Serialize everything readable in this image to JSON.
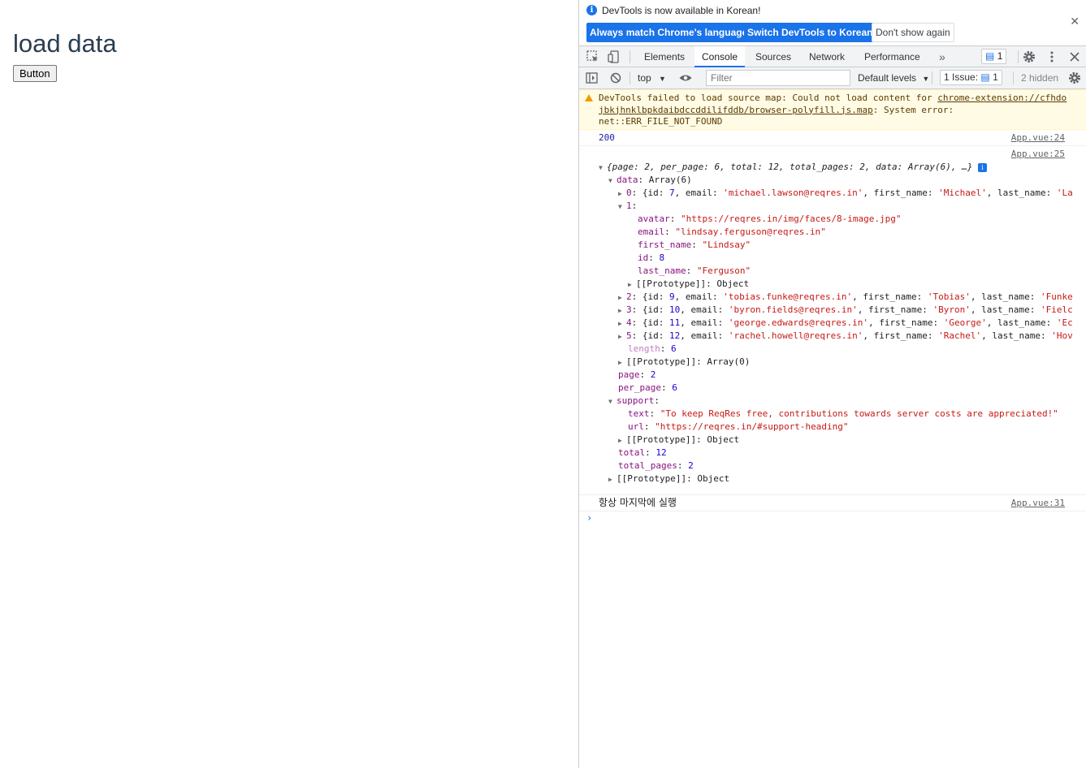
{
  "page": {
    "heading": "load data",
    "button_label": "Button"
  },
  "infobar": {
    "message": "DevTools is now available in Korean!",
    "btn_match": "Always match Chrome's language",
    "btn_switch": "Switch DevTools to Korean",
    "btn_dont_show": "Don't show again"
  },
  "tabs": [
    "Elements",
    "Console",
    "Sources",
    "Network",
    "Performance"
  ],
  "tabs_more": "»",
  "message_badge_count": "1",
  "toolbar": {
    "context": "top",
    "filter_placeholder": "Filter",
    "levels": "Default levels",
    "issue_label": "1 Issue:",
    "issue_count": "1",
    "hidden": "2 hidden"
  },
  "console": {
    "warning": {
      "prefix": "DevTools failed to load source map: Could not load content for ",
      "link1": "chrome-extension://cfhdo",
      "link2": "jbkjhnklbpkdaibdccddilifddb/browser-polyfill.js.map",
      "suffix": ": System error:",
      "line3": "net::ERR_FILE_NOT_FOUND"
    },
    "log200": {
      "value": "200",
      "source": "App.vue:24"
    },
    "object_source": "App.vue:25",
    "summary": "{page: 2, per_page: 6, total: 12, total_pages: 2, data: Array(6), …}",
    "data_label": "data",
    "data_type": "Array(6)",
    "rows": [
      {
        "index": "0",
        "id": "7",
        "email": "'michael.lawson@reqres.in'",
        "first_name": "'Michael'",
        "last_name_start": "'La"
      },
      {
        "index": "2",
        "id": "9",
        "email": "'tobias.funke@reqres.in'",
        "first_name": "'Tobias'",
        "last_name_start": "'Funke"
      },
      {
        "index": "3",
        "id": "10",
        "email": "'byron.fields@reqres.in'",
        "first_name": "'Byron'",
        "last_name_start": "'Fielc"
      },
      {
        "index": "4",
        "id": "11",
        "email": "'george.edwards@reqres.in'",
        "first_name": "'George'",
        "last_name_start": "'Ec"
      },
      {
        "index": "5",
        "id": "12",
        "email": "'rachel.howell@reqres.in'",
        "first_name": "'Rachel'",
        "last_name_start": "'Hov"
      }
    ],
    "expanded": {
      "index": "1",
      "avatar": "\"https://reqres.in/img/faces/8-image.jpg\"",
      "email": "\"lindsay.ferguson@reqres.in\"",
      "first_name": "\"Lindsay\"",
      "id": "8",
      "last_name": "\"Ferguson\"",
      "prototype": "Object"
    },
    "length": "6",
    "array_prototype": "Array(0)",
    "page": "2",
    "per_page": "6",
    "support": {
      "text": "\"To keep ReqRes free, contributions towards server costs are appreciated!\"",
      "url": "\"https://reqres.in/#support-heading\"",
      "prototype": "Object"
    },
    "total": "12",
    "total_pages": "2",
    "root_prototype": "Object",
    "korean_log": {
      "value": "항상 마지막에 실행",
      "source": "App.vue:31"
    },
    "prompt": "›"
  }
}
